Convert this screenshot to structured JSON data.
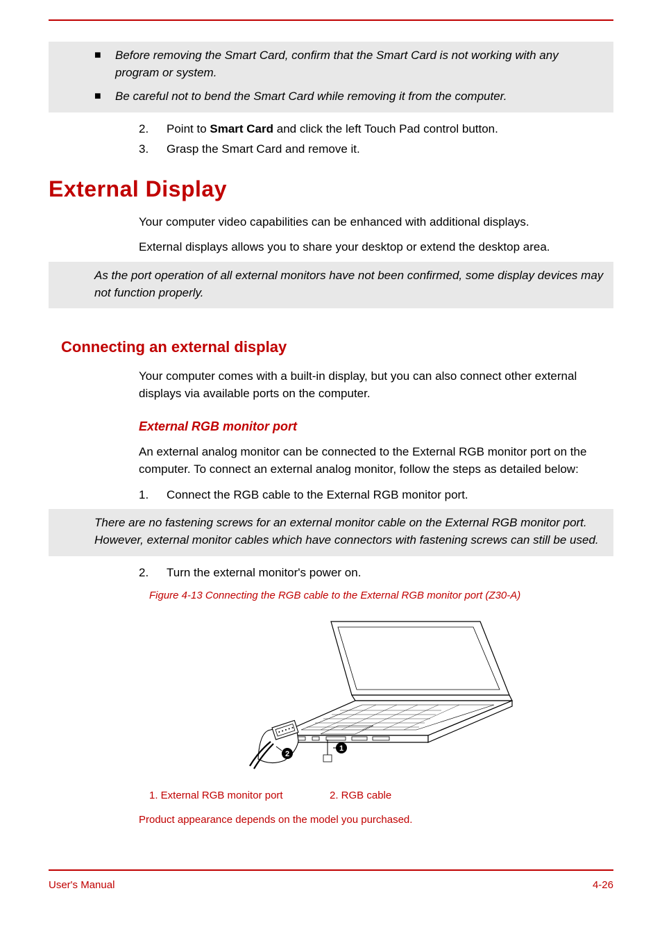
{
  "notes": {
    "smart_card_bullets": [
      "Before removing the Smart Card, confirm that the Smart Card is not working with any program or system.",
      "Be careful not to bend the Smart Card while removing it from the computer."
    ],
    "port_operation": "As the port operation of all external monitors have not been confirmed, some display devices may not function properly.",
    "no_screws": "There are no fastening screws for an external monitor cable on the External RGB monitor port. However, external monitor cables which have connectors with fastening screws can still be used."
  },
  "smart_card_steps": {
    "s2_pre": "Point to ",
    "s2_bold": "Smart Card",
    "s2_post": " and click the left Touch Pad control button.",
    "s3": "Grasp the Smart Card and remove it."
  },
  "headings": {
    "h1": "External Display",
    "h2": "Connecting an external display",
    "h3": "External RGB monitor port"
  },
  "paragraphs": {
    "p1": "Your computer video capabilities can be enhanced with additional displays.",
    "p2": "External displays allows you to share your desktop or extend the desktop area.",
    "p3": "Your computer comes with a built-in display, but you can also connect other external displays via available ports on the computer.",
    "p4": "An external analog monitor can be connected to the External RGB monitor port on the computer. To connect an external analog monitor, follow the steps as detailed below:"
  },
  "rgb_steps": {
    "s1": "Connect the RGB cable to the External RGB monitor port.",
    "s2": "Turn the external monitor's power on."
  },
  "figure": {
    "caption": "Figure 4-13 Connecting the RGB cable to the External RGB monitor port (Z30-A)",
    "legend1": "1. External RGB monitor port",
    "legend2": "2. RGB cable",
    "product_note": "Product appearance depends on the model you purchased."
  },
  "footer": {
    "left": "User's Manual",
    "right": "4-26"
  },
  "nums": {
    "n1": "1.",
    "n2": "2.",
    "n3": "3."
  },
  "marker": "■"
}
